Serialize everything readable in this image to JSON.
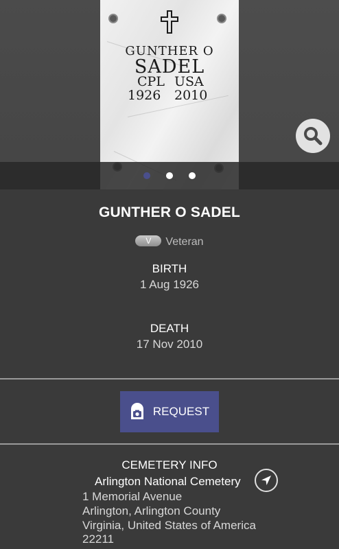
{
  "photo": {
    "stone_line1": "GUNTHER O",
    "stone_line2": "SADEL",
    "stone_rank": "CPL",
    "stone_branch": "USA",
    "stone_birth_year": "1926",
    "stone_death_year": "2010",
    "carousel_total": 3,
    "carousel_active": 0
  },
  "person": {
    "name": "GUNTHER O SADEL",
    "badge": "V",
    "badge_label": "Veteran",
    "birth_label": "BIRTH",
    "birth_date": "1 Aug 1926",
    "death_label": "DEATH",
    "death_date": "17 Nov 2010"
  },
  "request": {
    "label": "REQUEST"
  },
  "cemetery": {
    "title": "CEMETERY INFO",
    "name": "Arlington National Cemetery",
    "address_line1": "1 Memorial Avenue",
    "address_line2": "Arlington, Arlington County",
    "address_line3": "Virginia, United States of America",
    "address_line4": "22211"
  },
  "icons": {
    "search": "search-icon",
    "camera": "camera-icon",
    "navigate": "navigation-arrow-icon",
    "cross": "cross-icon"
  },
  "colors": {
    "background": "#3a3a3a",
    "accent": "#4a4f8c",
    "divider": "#9a9a9a"
  }
}
